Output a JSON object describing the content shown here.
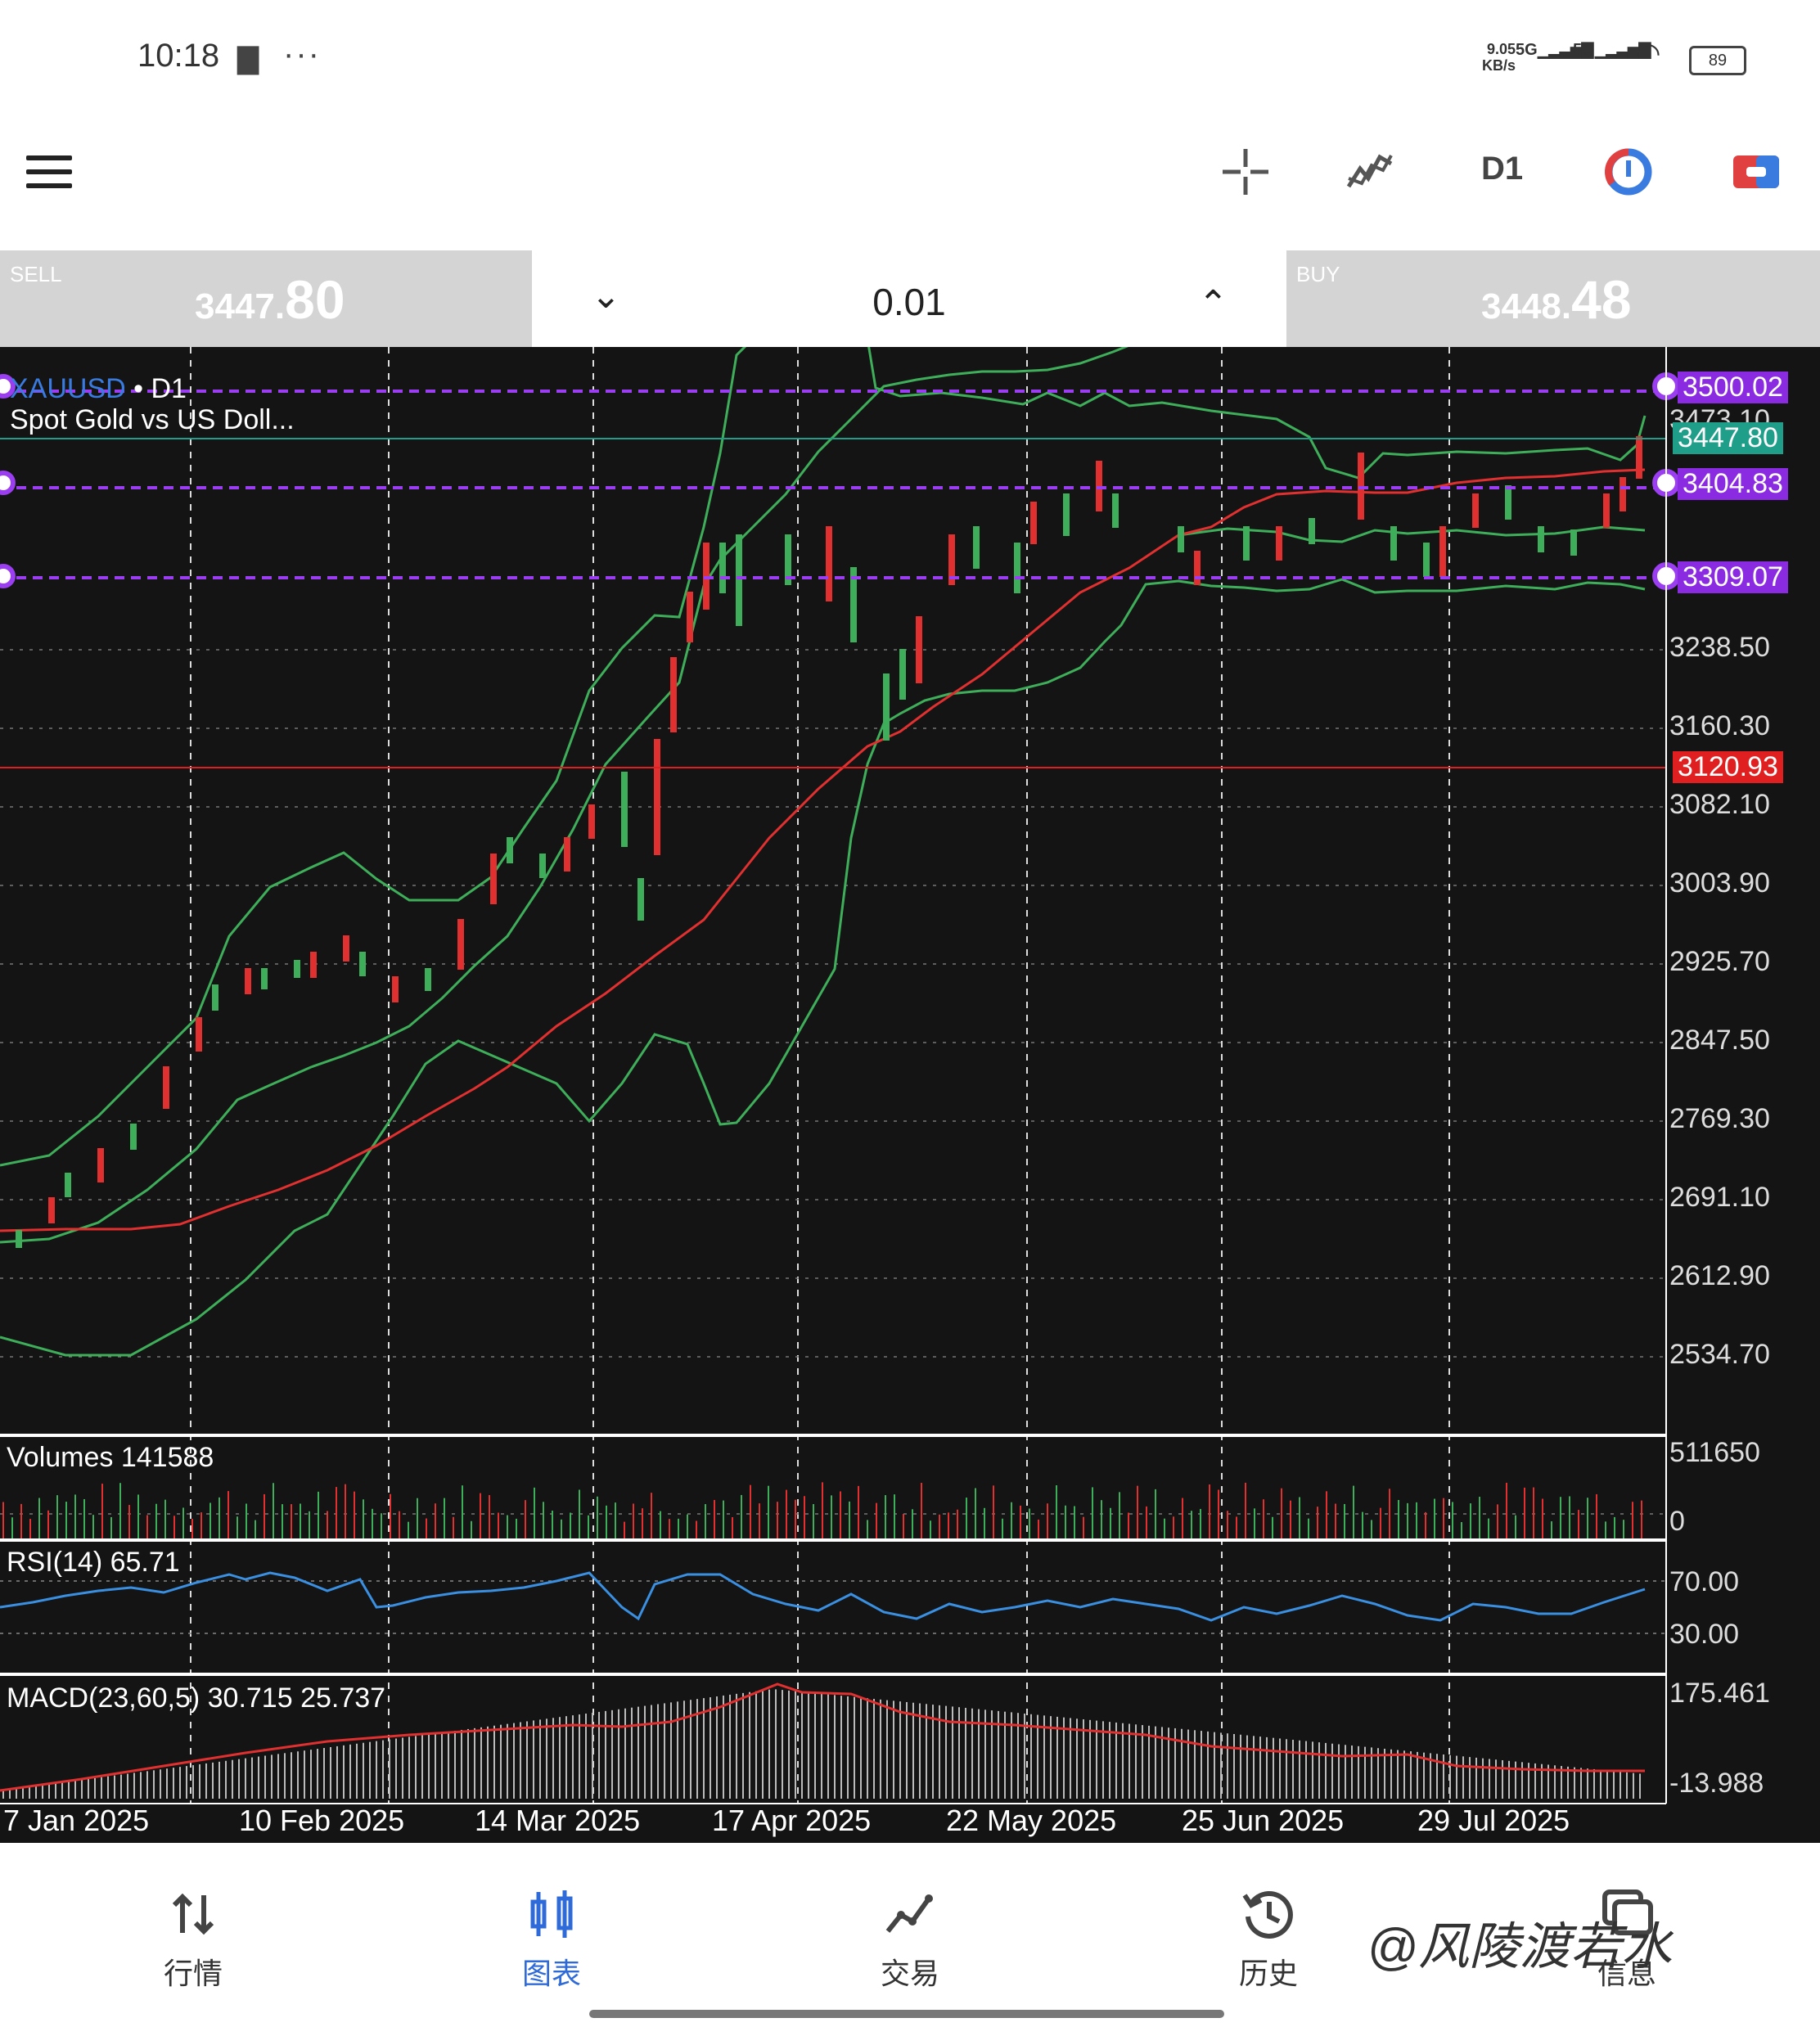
{
  "status_bar": {
    "time": "10:18",
    "net_speed_value": "9.05",
    "net_speed_unit": "KB/s",
    "sim1": "5G",
    "sim2": "5G",
    "battery": "89"
  },
  "toolbar": {
    "menu_icon": "hamburger-icon",
    "crosshair_icon": "crosshair-icon",
    "indicators_icon": "indicator-icon",
    "timeframe": "D1",
    "objects_icon": "objects-icon",
    "trade_icon": "trade-icon"
  },
  "trade_bar": {
    "sell_label": "SELL",
    "sell_price_main": "3447.",
    "sell_price_big": "80",
    "lot": "0.01",
    "buy_label": "BUY",
    "buy_price_main": "3448.",
    "buy_price_big": "48"
  },
  "chart": {
    "symbol": "XAUUSD",
    "timeframe": "D1",
    "description": "Spot Gold vs US Doll...",
    "price_labels": [
      "3473.10",
      "3238.50",
      "3160.30",
      "3082.10",
      "3003.90",
      "2925.70",
      "2847.50",
      "2769.30",
      "2691.10",
      "2612.90",
      "2534.70"
    ],
    "horizontal_lines": [
      {
        "value": "3500.02",
        "color": "#8a2be2"
      },
      {
        "value": "3404.83",
        "color": "#8a2be2"
      },
      {
        "value": "3309.07",
        "color": "#8a2be2"
      },
      {
        "value": "3447.80",
        "color": "#1f9e8a"
      },
      {
        "value": "3120.93",
        "color": "#e02020"
      }
    ],
    "volumes_label": "Volumes 141588",
    "volume_scale": [
      "511650",
      "0"
    ],
    "rsi_label": "RSI(14) 65.71",
    "rsi_scale": [
      "70.00",
      "30.00"
    ],
    "macd_label": "MACD(23,60,5) 30.715 25.737",
    "macd_scale": [
      "175.461",
      "-13.988"
    ],
    "dates": [
      "7 Jan 2025",
      "10 Feb 2025",
      "14 Mar 2025",
      "17 Apr 2025",
      "22 May 2025",
      "25 Jun 2025",
      "29 Jul 2025"
    ]
  },
  "bottom_nav": {
    "items": [
      {
        "label": "行情",
        "icon": "quotes-icon"
      },
      {
        "label": "图表",
        "icon": "chart-icon"
      },
      {
        "label": "交易",
        "icon": "trade-line-icon"
      },
      {
        "label": "历史",
        "icon": "history-icon"
      },
      {
        "label": "信息",
        "icon": "messages-icon"
      }
    ]
  },
  "watermark": "@风陵渡若水"
}
